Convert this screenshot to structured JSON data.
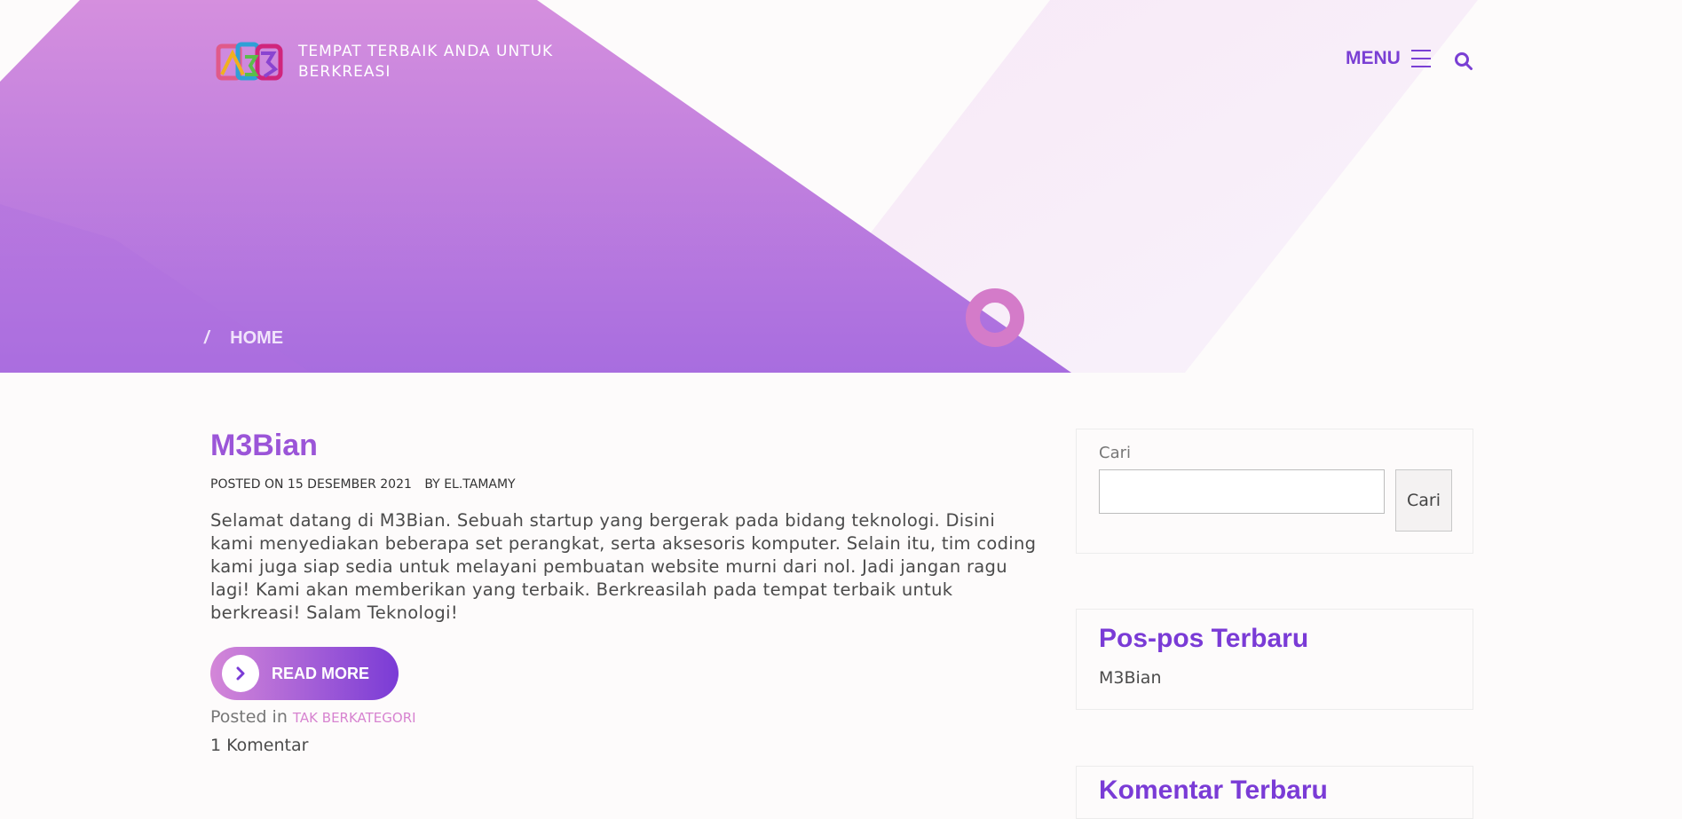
{
  "header": {
    "logo_name": "m3bian-logo",
    "tagline": "TEMPAT TERBAIK ANDA UNTUK BERKREASI",
    "menu_label": "MENU",
    "search_icon": "search-icon",
    "menu_icon": "hamburger-icon"
  },
  "breadcrumb": {
    "separator": "/",
    "home": "HOME"
  },
  "post": {
    "title": "M3Bian",
    "posted_on_label": "POSTED ON",
    "date": "15 DESEMBER 2021",
    "by_label": "BY",
    "author": "EL.TAMAMY",
    "excerpt": "Selamat datang di M3Bian. Sebuah startup yang bergerak pada bidang teknologi. Disini kami menyediakan beberapa set perangkat, serta aksesoris komputer. Selain itu, tim coding kami juga siap sedia untuk melayani pembuatan website murni dari nol. Jadi jangan ragu lagi! Kami akan memberikan yang terbaik. Berkreasilah pada tempat terbaik untuk berkreasi! Salam Teknologi!",
    "read_more": "READ MORE",
    "posted_in_label": "Posted in",
    "category": "TAK BERKATEGORI",
    "comments": "1 Komentar"
  },
  "sidebar": {
    "search": {
      "label": "Cari",
      "placeholder": "",
      "button": "Cari"
    },
    "recent_posts": {
      "title": "Pos-pos Terbaru",
      "items": [
        "M3Bian"
      ]
    },
    "recent_comments": {
      "title": "Komentar Terbaru"
    }
  },
  "colors": {
    "accent": "#7a3bd6",
    "post_title": "#9b55d8",
    "hero_gradient_top": "#d58fde",
    "hero_gradient_bottom": "#a86ddf",
    "category_link": "#d783d0"
  }
}
